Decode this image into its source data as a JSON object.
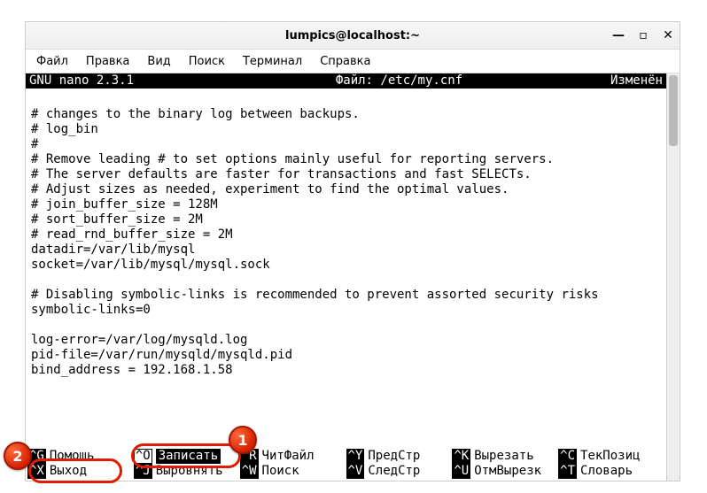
{
  "window": {
    "title": "lumpics@localhost:~",
    "controls": {
      "minimize": "—",
      "maximize": "▫",
      "close": "✕"
    }
  },
  "menu": {
    "items": [
      "Файл",
      "Правка",
      "Вид",
      "Поиск",
      "Терминал",
      "Справка"
    ]
  },
  "nano": {
    "header_left": "  GNU nano 2.3.1",
    "header_center": "Файл: /etc/my.cnf",
    "header_right": "Изменён",
    "lines": [
      "",
      "# changes to the binary log between backups.",
      "# log_bin",
      "#",
      "# Remove leading # to set options mainly useful for reporting servers.",
      "# The server defaults are faster for transactions and fast SELECTs.",
      "# Adjust sizes as needed, experiment to find the optimal values.",
      "# join_buffer_size = 128M",
      "# sort_buffer_size = 2M",
      "# read_rnd_buffer_size = 2M",
      "datadir=/var/lib/mysql",
      "socket=/var/lib/mysql/mysql.sock",
      "",
      "# Disabling symbolic-links is recommended to prevent assorted security risks",
      "symbolic-links=0",
      "",
      "log-error=/var/log/mysqld.log",
      "pid-file=/var/run/mysqld/mysqld.pid",
      "bind_address = 192.168.1.58",
      ""
    ],
    "shortcuts_row1": [
      {
        "key": "^G",
        "label": "Помощь",
        "hl": false
      },
      {
        "key": "^O",
        "label": "Записать",
        "hl": true
      },
      {
        "key": "^R",
        "label": "ЧитФайл",
        "hl": false
      },
      {
        "key": "^Y",
        "label": "ПредСтр",
        "hl": false
      },
      {
        "key": "^K",
        "label": "Вырезать",
        "hl": false
      },
      {
        "key": "^C",
        "label": "ТекПозиц",
        "hl": false
      }
    ],
    "shortcuts_row2": [
      {
        "key": "^X",
        "label": "Выход",
        "hl": false
      },
      {
        "key": "^J",
        "label": "Выровнять",
        "hl": false
      },
      {
        "key": "^W",
        "label": "Поиск",
        "hl": false
      },
      {
        "key": "^V",
        "label": "СледСтр",
        "hl": false
      },
      {
        "key": "^U",
        "label": "ОтмВырезк",
        "hl": false
      },
      {
        "key": "^T",
        "label": "Словарь",
        "hl": false
      }
    ]
  },
  "callouts": {
    "one": "1",
    "two": "2"
  }
}
